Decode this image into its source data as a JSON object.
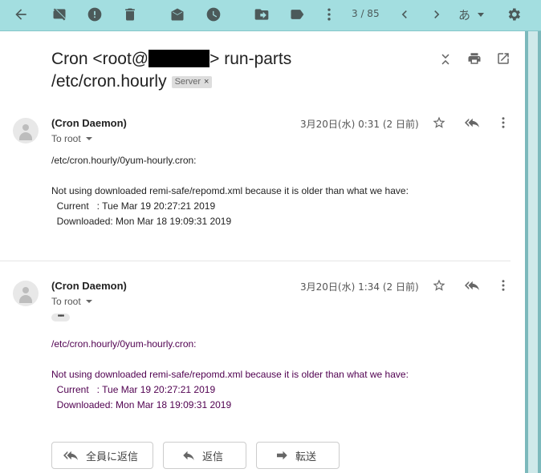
{
  "toolbar": {
    "icons": [
      "back-arrow-icon",
      "archive-off-icon",
      "report-spam-icon",
      "trash-icon",
      "mark-unread-icon",
      "snooze-icon",
      "move-to-icon",
      "label-icon",
      "more-vert-icon",
      "prev-icon",
      "next-icon",
      "settings-icon"
    ],
    "pager": "3 / 85",
    "input_tool": "あ"
  },
  "subject": {
    "line1_before": "Cron <root@",
    "line1_after": "> run-parts",
    "line2": "/etc/cron.hourly",
    "label": "Server",
    "label_remove": "×"
  },
  "messages": [
    {
      "sender": "(Cron Daemon)",
      "to": "To root",
      "date": "3月20日(水) 0:31 (2 日前)",
      "body": "/etc/cron.hourly/0yum-hourly.cron:\n\nNot using downloaded remi-safe/repomd.xml because it is older than what we have:\n  Current   : Tue Mar 19 20:27:21 2019\n  Downloaded: Mon Mar 18 19:09:31 2019"
    },
    {
      "sender": "(Cron Daemon)",
      "to": "To root",
      "date": "3月20日(水) 1:34 (2 日前)",
      "ellipsis": "•••",
      "body": "/etc/cron.hourly/0yum-hourly.cron:\n\nNot using downloaded remi-safe/repomd.xml because it is older than what we have:\n  Current   : Tue Mar 19 20:27:21 2019\n  Downloaded: Mon Mar 18 19:09:31 2019"
    }
  ],
  "actions": {
    "reply_all": "全員に返信",
    "reply": "返信",
    "forward": "転送"
  },
  "colors": {
    "toolbar_bg": "#a3dee0",
    "side_strip": "#7cb9bc",
    "quoted_text": "#500050"
  }
}
